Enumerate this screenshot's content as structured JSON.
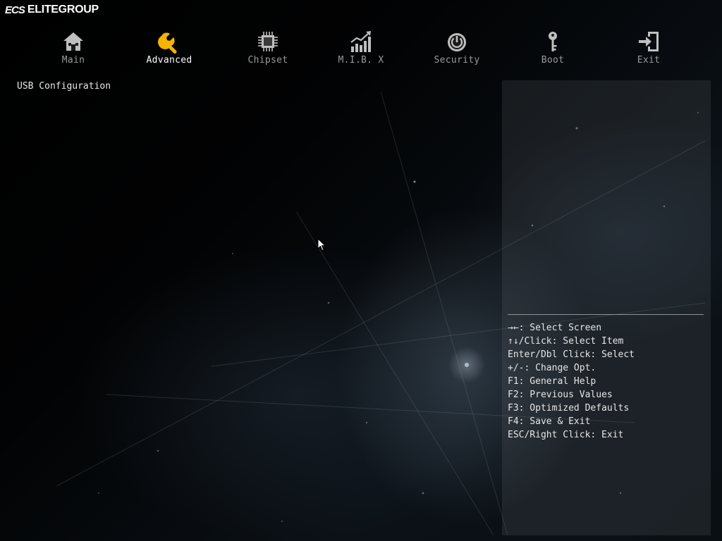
{
  "brand": {
    "mark": "ECS",
    "name": "ELITEGROUP"
  },
  "tabs": [
    {
      "label": "Main",
      "icon": "home-icon",
      "active": false
    },
    {
      "label": "Advanced",
      "icon": "wrench-icon",
      "active": true
    },
    {
      "label": "Chipset",
      "icon": "chip-icon",
      "active": false
    },
    {
      "label": "M.I.B. X",
      "icon": "chart-icon",
      "active": false
    },
    {
      "label": "Security",
      "icon": "power-shield-icon",
      "active": false
    },
    {
      "label": "Boot",
      "icon": "key-icon",
      "active": false
    },
    {
      "label": "Exit",
      "icon": "exit-icon",
      "active": false
    }
  ],
  "main": {
    "section_title": "USB Configuration"
  },
  "help": {
    "items": [
      "→←: Select Screen",
      "↑↓/Click: Select Item",
      "Enter/Dbl Click: Select",
      "+/-: Change Opt.",
      "F1: General Help",
      "F2: Previous Values",
      "F3: Optimized Defaults",
      "F4: Save & Exit",
      "ESC/Right Click: Exit"
    ]
  },
  "colors": {
    "active_icon": "#f5b400",
    "inactive_icon": "#bfbfbf",
    "active_label": "#ffffff",
    "inactive_label": "#9a9a9a"
  }
}
